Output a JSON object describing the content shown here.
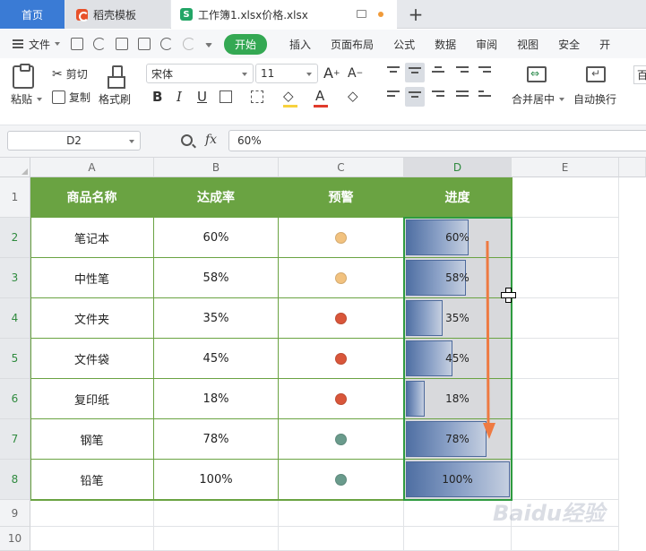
{
  "tabs": {
    "home": "首页",
    "template": "稻壳模板",
    "document": "工作簿1.xlsx价格.xlsx",
    "doc_icon_letter": "S",
    "add": "+"
  },
  "menu": {
    "file": "文件",
    "items": [
      "开始",
      "插入",
      "页面布局",
      "公式",
      "数据",
      "审阅",
      "视图",
      "安全",
      "开"
    ]
  },
  "ribbon": {
    "paste": "粘贴",
    "cut": "剪切",
    "copy": "复制",
    "format_painter": "格式刷",
    "font_name": "宋体",
    "font_size": "11",
    "bold": "B",
    "italic": "I",
    "underline": "U",
    "font_grow": "A",
    "font_shrink": "A",
    "font_color_letter": "A",
    "merge_center": "合并居中",
    "wrap_text": "自动换行",
    "more": "百"
  },
  "formula_bar": {
    "name_box": "D2",
    "fx": "fx",
    "value": "60%"
  },
  "grid": {
    "columns": [
      "A",
      "B",
      "C",
      "D",
      "E"
    ],
    "rows": [
      "1",
      "2",
      "3",
      "4",
      "5",
      "6",
      "7",
      "8",
      "9",
      "10"
    ],
    "headers": [
      "商品名称",
      "达成率",
      "预警",
      "进度"
    ],
    "data": [
      {
        "name": "笔记本",
        "rate": "60%",
        "warn": "#f2c27f",
        "progress": 0.6
      },
      {
        "name": "中性笔",
        "rate": "58%",
        "warn": "#f2c27f",
        "progress": 0.58
      },
      {
        "name": "文件夹",
        "rate": "35%",
        "warn": "#d9563a",
        "progress": 0.35
      },
      {
        "name": "文件袋",
        "rate": "45%",
        "warn": "#d9563a",
        "progress": 0.45
      },
      {
        "name": "复印纸",
        "rate": "18%",
        "warn": "#d9563a",
        "progress": 0.18
      },
      {
        "name": "钢笔",
        "rate": "78%",
        "warn": "#6a9b8c",
        "progress": 0.78
      },
      {
        "name": "铅笔",
        "rate": "100%",
        "warn": "#6a9b8c",
        "progress": 1.0
      }
    ]
  },
  "colors": {
    "accent_green": "#34a853",
    "header_green": "#6aa342",
    "selection_green": "#2e9b3f",
    "arrow_orange": "#ee7a42"
  },
  "watermark": "Baidu经验"
}
